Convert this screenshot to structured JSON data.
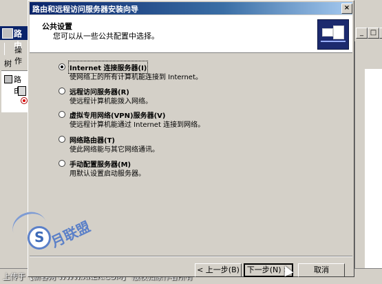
{
  "background_window": {
    "title_fragment": "路由",
    "menu_fragment": "操作",
    "tab_fragment": "树",
    "tree_item_fragment": "路由",
    "minimize_symbol": "_",
    "close_symbol": "×"
  },
  "dialog": {
    "title": "路由和远程访问服务器安装向导",
    "close_symbol": "×",
    "header": {
      "title": "公共设置",
      "subtitle": "您可以从一些公共配置中选择。"
    },
    "options": [
      {
        "label": "Internet 连接服务器(I)",
        "desc": "使网络上的所有计算机能连接到 Internet。",
        "selected": true
      },
      {
        "label": "远程访问服务器(R)",
        "desc": "使远程计算机能拨入网络。",
        "selected": false
      },
      {
        "label": "虚拟专用网络(VPN)服务器(V)",
        "desc": "使远程计算机能通过 Internet 连接到网络。",
        "selected": false
      },
      {
        "label": "网络路由器(T)",
        "desc": "使此网络能与其它网络通讯。",
        "selected": false
      },
      {
        "label": "手动配置服务器(M)",
        "desc": "用默认设置启动服务器。",
        "selected": false
      }
    ],
    "buttons": {
      "back": "< 上一步(B)",
      "next": "下一步(N) >",
      "cancel": "取消"
    }
  },
  "status_text": "上传于【新客网 WWW.XKER.COM】 版权归原作者所有",
  "watermark": {
    "text": "月联盟"
  }
}
